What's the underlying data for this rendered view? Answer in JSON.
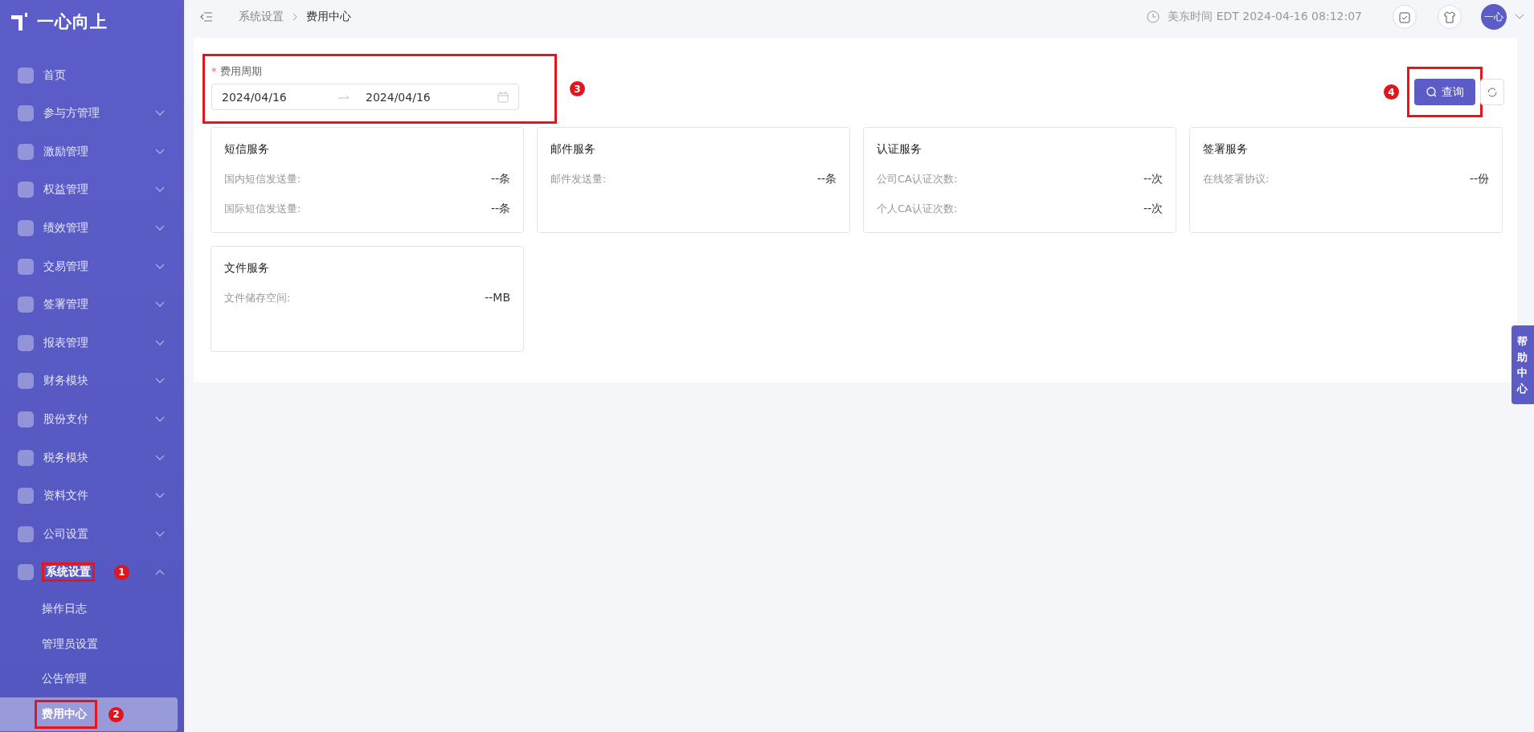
{
  "logo": {
    "text": "一心向上"
  },
  "sidebar": {
    "items": [
      {
        "label": "首页",
        "expanded": false,
        "has_children": false
      },
      {
        "label": "参与方管理",
        "expanded": false,
        "has_children": true
      },
      {
        "label": "激励管理",
        "expanded": false,
        "has_children": true
      },
      {
        "label": "权益管理",
        "expanded": false,
        "has_children": true
      },
      {
        "label": "绩效管理",
        "expanded": false,
        "has_children": true
      },
      {
        "label": "交易管理",
        "expanded": false,
        "has_children": true
      },
      {
        "label": "签署管理",
        "expanded": false,
        "has_children": true
      },
      {
        "label": "报表管理",
        "expanded": false,
        "has_children": true
      },
      {
        "label": "财务模块",
        "expanded": false,
        "has_children": true
      },
      {
        "label": "股份支付",
        "expanded": false,
        "has_children": true
      },
      {
        "label": "税务模块",
        "expanded": false,
        "has_children": true
      },
      {
        "label": "资料文件",
        "expanded": false,
        "has_children": true
      },
      {
        "label": "公司设置",
        "expanded": false,
        "has_children": true
      },
      {
        "label": "系统设置",
        "expanded": true,
        "has_children": true,
        "callout": "1",
        "children": [
          {
            "label": "操作日志",
            "selected": false
          },
          {
            "label": "管理员设置",
            "selected": false
          },
          {
            "label": "公告管理",
            "selected": false
          },
          {
            "label": "费用中心",
            "selected": true,
            "callout": "2"
          }
        ]
      }
    ]
  },
  "breadcrumb": [
    {
      "label": "系统设置",
      "current": false
    },
    {
      "label": "费用中心",
      "current": true
    }
  ],
  "header": {
    "time": "美东时间 EDT 2024-04-16 08:12:07",
    "avatar": "一心"
  },
  "filter": {
    "label": "费用周期",
    "required_mark": "*",
    "start": "2024/04/16",
    "end": "2024/04/16",
    "callout": "3"
  },
  "query_button": {
    "label": "查询",
    "callout": "4"
  },
  "cards": [
    {
      "title": "短信服务",
      "rows": [
        {
          "label": "国内短信发送量:",
          "value": "--条"
        },
        {
          "label": "国际短信发送量:",
          "value": "--条"
        }
      ]
    },
    {
      "title": "邮件服务",
      "rows": [
        {
          "label": "邮件发送量:",
          "value": "--条"
        }
      ]
    },
    {
      "title": "认证服务",
      "rows": [
        {
          "label": "公司CA认证次数:",
          "value": "--次"
        },
        {
          "label": "个人CA认证次数:",
          "value": "--次"
        }
      ]
    },
    {
      "title": "签署服务",
      "rows": [
        {
          "label": "在线签署协议:",
          "value": "--份"
        }
      ]
    },
    {
      "title": "文件服务",
      "rows": [
        {
          "label": "文件储存空间:",
          "value": "--MB"
        }
      ]
    }
  ],
  "help_tab": {
    "label": "帮助中心"
  }
}
